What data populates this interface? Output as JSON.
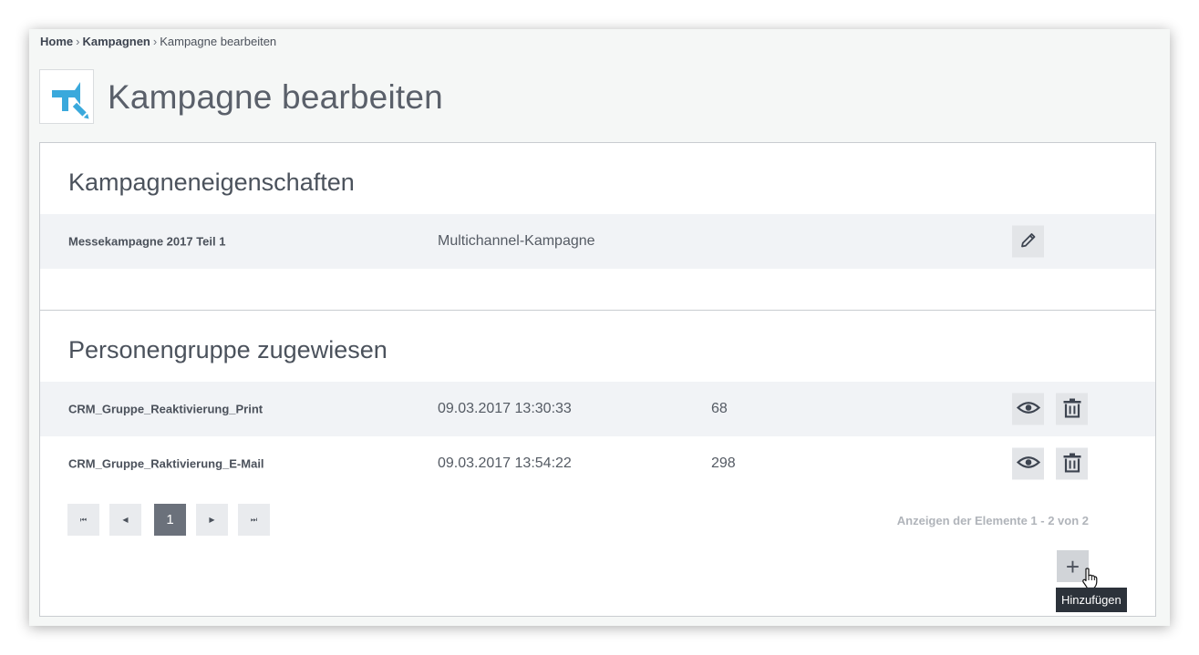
{
  "breadcrumb": {
    "home": "Home",
    "separator": "›",
    "kampagnen": "Kampagnen",
    "current": "Kampagne bearbeiten"
  },
  "page": {
    "title": "Kampagne bearbeiten",
    "icon": "megaphone-edit-icon"
  },
  "properties": {
    "title": "Kampagneneigenschaften",
    "row": {
      "name": "Messekampagne 2017 Teil 1",
      "type": "Multichannel-Kampagne",
      "action_icon": "pencil-icon"
    }
  },
  "groups": {
    "title": "Personengruppe zugewiesen",
    "rows": [
      {
        "name": "CRM_Gruppe_Reaktivierung_Print",
        "date": "09.03.2017 13:30:33",
        "count": "68"
      },
      {
        "name": "CRM_Gruppe_Raktivierung_E-Mail",
        "date": "09.03.2017 13:54:22",
        "count": "298"
      }
    ],
    "row_icons": [
      "eye-icon",
      "trash-icon"
    ]
  },
  "pager": {
    "current_page": "1",
    "first_glyph": "⏮",
    "prev_glyph": "◀",
    "next_glyph": "▶",
    "last_glyph": "⏭",
    "info": "Anzeigen der Elemente 1 - 2 von 2"
  },
  "add": {
    "glyph": "+",
    "tooltip": "Hinzufügen"
  },
  "colors": {
    "accent": "#3aa9dc",
    "active_page": "#6b717b",
    "tooltip_bg": "#2c323a"
  }
}
